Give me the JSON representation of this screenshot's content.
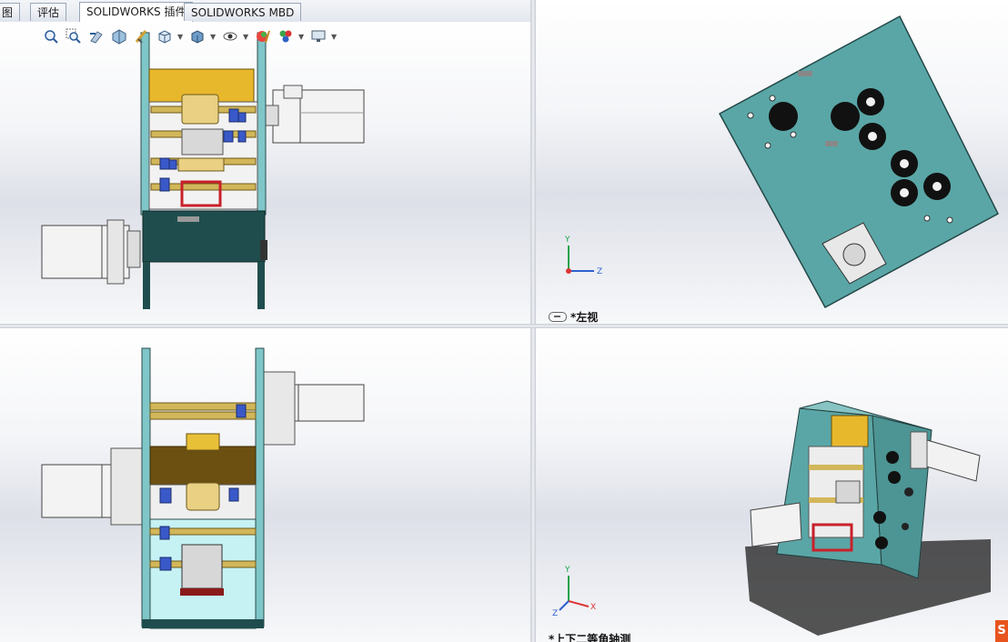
{
  "tabs": [
    {
      "label": "图",
      "active": false
    },
    {
      "label": "评估",
      "active": false
    },
    {
      "label": "SOLIDWORKS 插件",
      "active": true
    },
    {
      "label": "SOLIDWORKS MBD",
      "active": false
    }
  ],
  "hud_tools": [
    "zoom-to-fit-icon",
    "zoom-to-area-icon",
    "previous-view-icon",
    "section-view-icon",
    "dynamic-annotation-icon",
    "view-orientation-icon",
    "display-style-icon",
    "hide-show-items-icon",
    "edit-appearance-icon",
    "apply-scene-icon",
    "view-settings-icon"
  ],
  "viewports": {
    "top_left": {
      "label": ""
    },
    "top_right": {
      "label": "*左视"
    },
    "bottom_left": {
      "label": ""
    },
    "bottom_right": {
      "label": "*上下二等角轴测"
    }
  },
  "triad": {
    "x": "X",
    "y": "Y",
    "z": "Z"
  },
  "colors": {
    "frame_teal": "#5aa6a6",
    "dark_base": "#1f4d4d",
    "gold": "#d9b84a",
    "shaft_brass": "#c9a94a",
    "bearing_blue": "#3a59c9",
    "red_part": "#c8202a",
    "cyan_panel": "#c6f2f4"
  },
  "brand_badge": "S"
}
